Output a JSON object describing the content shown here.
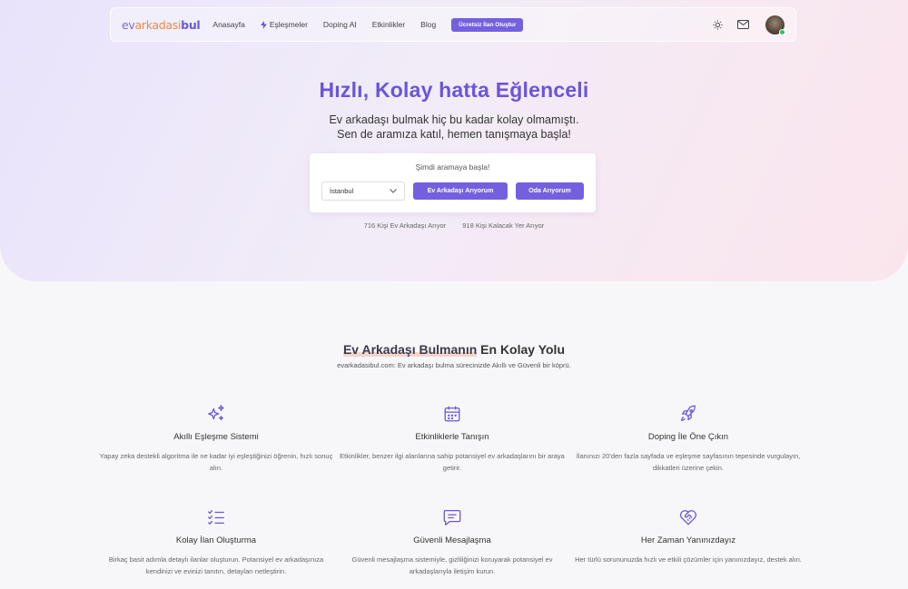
{
  "nav": {
    "logo_part1": "ev",
    "logo_part2": "arkadasi",
    "logo_part3": "bul",
    "items": [
      "Anasayfa",
      "Eşleşmeler",
      "Doping AI",
      "Etkinlikler",
      "Blog"
    ],
    "cta": "Ücretsiz İlan Oluştur",
    "icons": [
      "sun-icon",
      "mail-icon"
    ]
  },
  "hero": {
    "title": "Hızlı, Kolay hatta Eğlenceli",
    "subtitle_line1": "Ev arkadaşı bulmak hiç bu kadar kolay olmamıştı.",
    "subtitle_line2": "Sen de aramıza katıl, hemen tanışmaya başla!"
  },
  "search": {
    "label": "Şimdi aramaya başla!",
    "city": "İstanbul",
    "btn_roommate": "Ev Arkadaşı Arıyorum",
    "btn_room": "Oda Arıyorum"
  },
  "stats": {
    "roommate_count": "716 Kişi Ev Arkadaşı Arıyor",
    "place_count": "918 Kişi Kalacak Yer Arıyor"
  },
  "section": {
    "title_highlight": "Ev Arkadaşı Bulmanın",
    "title_rest": " En Kolay Yolu",
    "subtitle": "evarkadasibul.com: Ev arkadaşı bulma sürecinizde Akıllı ve Güvenli bir köprü."
  },
  "features": [
    {
      "icon": "sparkles-icon",
      "title": "Akıllı Eşleşme Sistemi",
      "desc": "Yapay zeka destekli algoritma ile ne kadar iyi eşleştiğinizi öğrenin, hızlı sonuç alın."
    },
    {
      "icon": "calendar-icon",
      "title": "Etkinliklerle Tanışın",
      "desc": "Etkinlikler, benzer ilgi alanlarına sahip potansiyel ev arkadaşlarını bir araya getirir."
    },
    {
      "icon": "rocket-icon",
      "title": "Doping İle Öne Çıkın",
      "desc": "İlanınızı 20'den fazla sayfada ve eşleşme sayfasının tepesinde vurgulayın, dikkatleri üzerine çekin."
    },
    {
      "icon": "checklist-icon",
      "title": "Kolay İlan Oluşturma",
      "desc": "Birkaç basit adımla detaylı ilanlar oluşturun. Potansiyel ev arkadaşınıza kendinizi ve evinizi tanıtın, detayları netleştirin."
    },
    {
      "icon": "message-icon",
      "title": "Güvenli Mesajlaşma",
      "desc": "Güvenli mesajlaşma sistemiyle, gizliliğinizi koruyarak potansiyel ev arkadaşlarıyla iletişim kurun."
    },
    {
      "icon": "heart-handshake-icon",
      "title": "Her Zaman Yanınızdayız",
      "desc": "Her türlü sorununuzda hızlı ve etkili çözümler için yanınızdayız, destek alın."
    }
  ],
  "colors": {
    "accent": "#7460de",
    "title": "#6b55d8",
    "logo_orange": "#f0883e"
  }
}
